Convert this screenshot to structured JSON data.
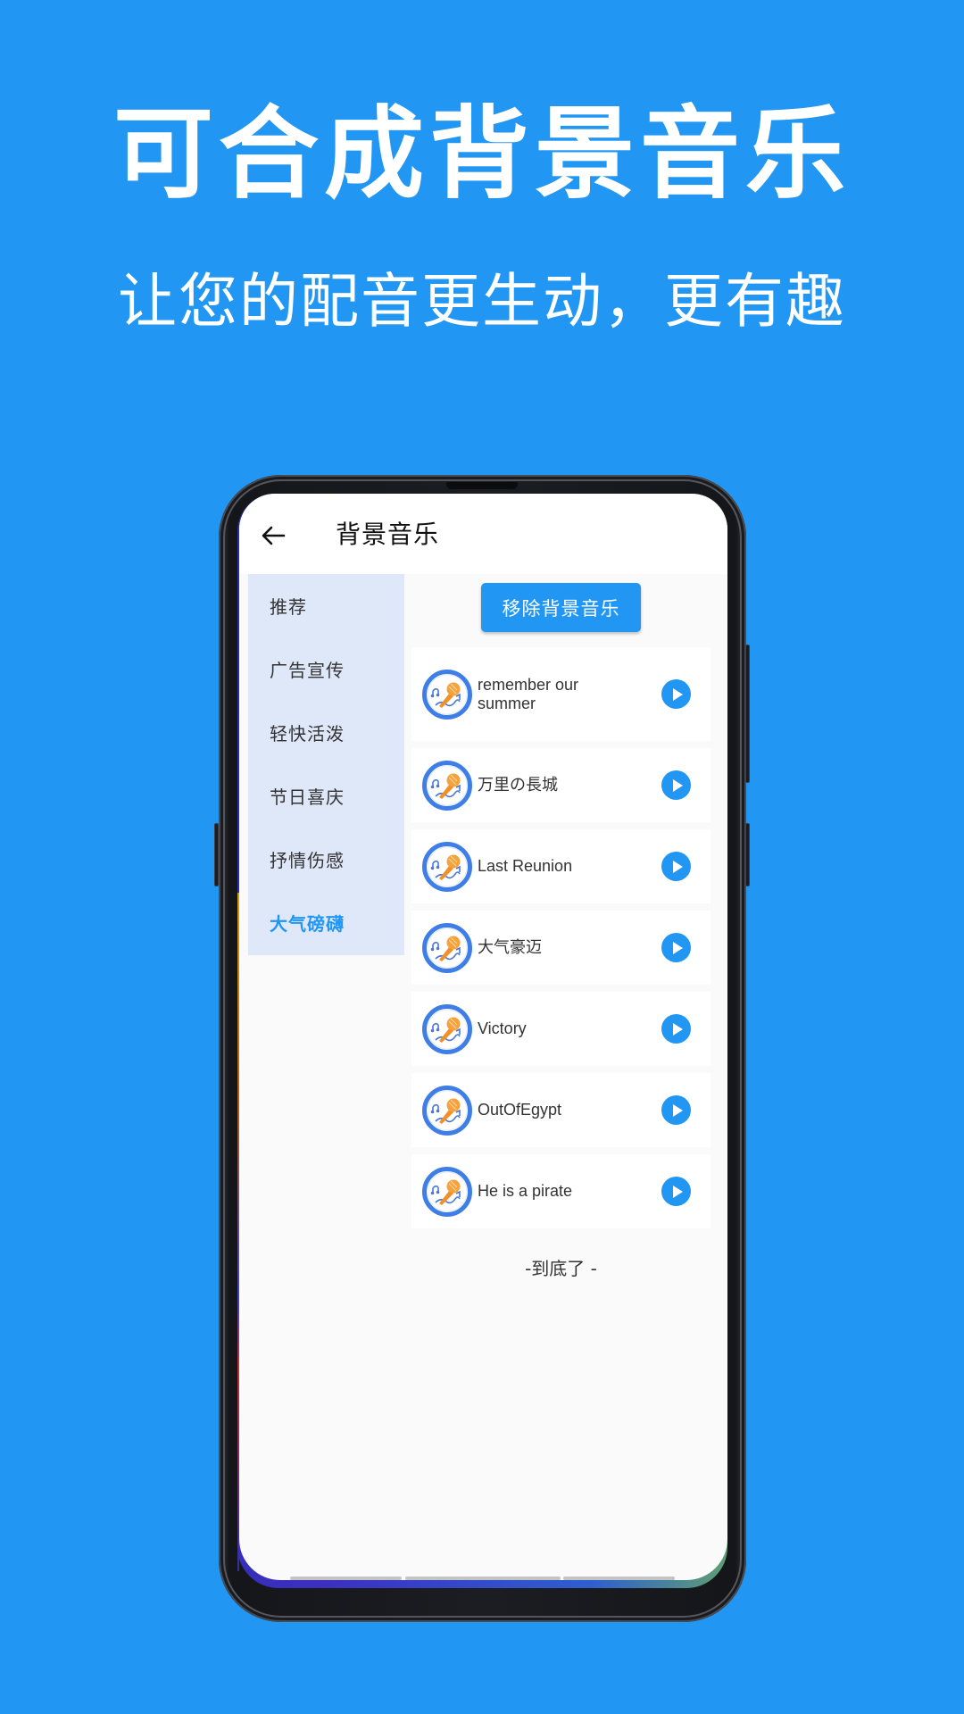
{
  "promo": {
    "headline": "可合成背景音乐",
    "subline": "让您的配音更生动，更有趣"
  },
  "app": {
    "title": "背景音乐",
    "back_icon": "arrow-left-icon",
    "remove_button": "移除背景音乐",
    "end_note": "-到底了 -"
  },
  "sidebar": {
    "active_index": 5,
    "items": [
      {
        "label": "推荐"
      },
      {
        "label": "广告宣传"
      },
      {
        "label": "轻快活泼"
      },
      {
        "label": "节日喜庆"
      },
      {
        "label": "抒情伤感"
      },
      {
        "label": "大气磅礴"
      }
    ]
  },
  "tracks": [
    {
      "name": "remember our summer",
      "icon": "microphone-music-icon",
      "action_icon": "play-icon"
    },
    {
      "name": "万里の長城",
      "icon": "microphone-music-icon",
      "action_icon": "play-icon"
    },
    {
      "name": "Last Reunion",
      "icon": "microphone-music-icon",
      "action_icon": "play-icon"
    },
    {
      "name": "大气豪迈",
      "icon": "microphone-music-icon",
      "action_icon": "play-icon"
    },
    {
      "name": "Victory",
      "icon": "microphone-music-icon",
      "action_icon": "play-icon"
    },
    {
      "name": "OutOfEgypt",
      "icon": "microphone-music-icon",
      "action_icon": "play-icon"
    },
    {
      "name": "He is a pirate",
      "icon": "microphone-music-icon",
      "action_icon": "play-icon"
    }
  ],
  "colors": {
    "background": "#2196f3",
    "accent": "#2196f3",
    "sidebar_bg": "#dfe8f9",
    "text": "#333333"
  }
}
